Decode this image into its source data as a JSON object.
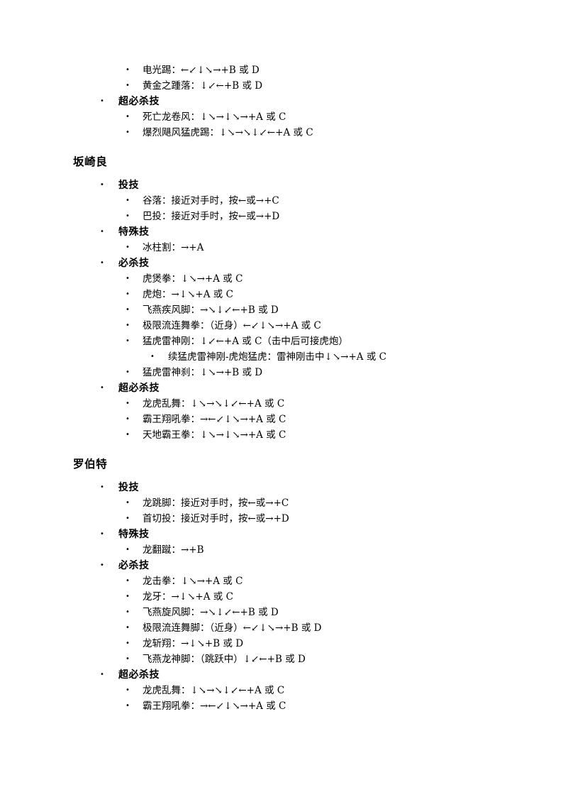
{
  "document": {
    "bullet_glyph": "•",
    "sections": [
      {
        "id": "continued-moves",
        "heading": null,
        "groups": [
          {
            "label": null,
            "moves": [
              {
                "text": "电光踢：←↙↓↘→+B 或 D"
              },
              {
                "text": "黄金之踵落：↓↙←+B 或 D"
              }
            ]
          },
          {
            "label": "超必杀技",
            "moves": [
              {
                "text": "死亡龙卷风：↓↘→↓↘→+A 或 C"
              },
              {
                "text": "爆烈飓风猛虎踢：↓↘→↘↓↙←+A 或 C"
              }
            ]
          }
        ]
      },
      {
        "id": "sakazaki-ryo",
        "heading": "坂崎良",
        "groups": [
          {
            "label": "投技",
            "moves": [
              {
                "text": "谷落：接近对手时，按←或→+C"
              },
              {
                "text": "巴投：接近对手时，按←或→+D"
              }
            ]
          },
          {
            "label": "特殊技",
            "moves": [
              {
                "text": "冰柱割：→+A"
              }
            ]
          },
          {
            "label": "必杀技",
            "moves": [
              {
                "text": "虎煲拳：↓↘→+A 或 C"
              },
              {
                "text": "虎炮：→↓↘+A 或 C"
              },
              {
                "text": "飞燕疾风脚：→↘↓↙←+B 或 D"
              },
              {
                "text": "极限流连舞拳：（近身）←↙↓↘→+A 或 C"
              },
              {
                "text": "猛虎雷神刚：↓↙←+A 或 C（击中后可接虎炮）",
                "sub": [
                  {
                    "text": "续猛虎雷神刚-虎炮猛虎：雷神刚击中↓↘→+A 或 C"
                  }
                ]
              },
              {
                "text": "猛虎雷神刹：↓↘→+B 或 D"
              }
            ]
          },
          {
            "label": "超必杀技",
            "moves": [
              {
                "text": "龙虎乱舞：↓↘→↘↓↙←+A 或 C"
              },
              {
                "text": "霸王翔吼拳：→←↙↓↘→+A 或 C"
              },
              {
                "text": "天地霸王拳：↓↘→↓↘→+A 或 C"
              }
            ]
          }
        ]
      },
      {
        "id": "robert",
        "heading": "罗伯特",
        "groups": [
          {
            "label": "投技",
            "moves": [
              {
                "text": "龙跳脚：接近对手时，按←或→+C"
              },
              {
                "text": "首切投：接近对手时，按←或→+D"
              }
            ]
          },
          {
            "label": "特殊技",
            "moves": [
              {
                "text": "龙翻蹴：→+B"
              }
            ]
          },
          {
            "label": "必杀技",
            "moves": [
              {
                "text": "龙击拳：↓↘→+A 或 C"
              },
              {
                "text": "龙牙：→↓↘+A 或 C"
              },
              {
                "text": "飞燕旋风脚：→↘↓↙←+B 或 D"
              },
              {
                "text": "极限流连舞脚：（近身）←↙↓↘→+B 或 D"
              },
              {
                "text": "龙斩翔：→↓↘+B 或 D"
              },
              {
                "text": "飞燕龙神脚：（跳跃中）↓↙←+B 或 D"
              }
            ]
          },
          {
            "label": "超必杀技",
            "moves": [
              {
                "text": "龙虎乱舞：↓↘→↘↓↙←+A 或 C"
              },
              {
                "text": "霸王翔吼拳：→←↙↓↘→+A 或 C"
              }
            ]
          }
        ]
      }
    ]
  }
}
